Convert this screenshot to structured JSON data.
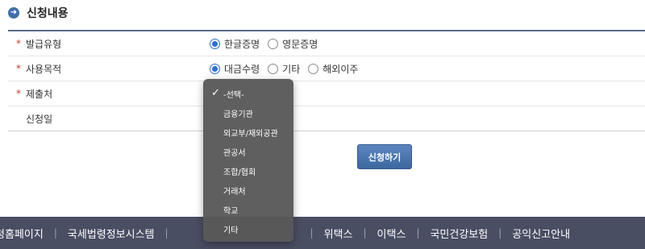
{
  "section": {
    "title": "신청내용",
    "icon": "arrow-right-circle-icon"
  },
  "form": {
    "required_mark": "*",
    "rows": [
      {
        "label": "발급유형",
        "required": true,
        "options": [
          "한글증명",
          "영문증명"
        ],
        "selected": "한글증명"
      },
      {
        "label": "사용목적",
        "required": true,
        "options": [
          "대금수령",
          "기타",
          "해외이주"
        ],
        "selected": "대금수령"
      },
      {
        "label": "제출처",
        "required": true
      },
      {
        "label": "신청일",
        "required": false
      }
    ],
    "submit_label": "신청하기"
  },
  "dropdown": {
    "selected": "-선택-",
    "options": [
      "-선택-",
      "금융기관",
      "외교부/재외공관",
      "관공서",
      "조합/협회",
      "거래처",
      "학교",
      "기타"
    ]
  },
  "footer": {
    "links": [
      "청홈페이지",
      "국세법령정보시스템",
      "",
      "위택스",
      "이택스",
      "국민건강보험",
      "공익신고안내"
    ],
    "separator": "|"
  },
  "colors": {
    "accent": "#3f6fa8",
    "required": "#c8352b",
    "footer_bg": "#4a4e63",
    "radio_on": "#2b6fd6"
  }
}
